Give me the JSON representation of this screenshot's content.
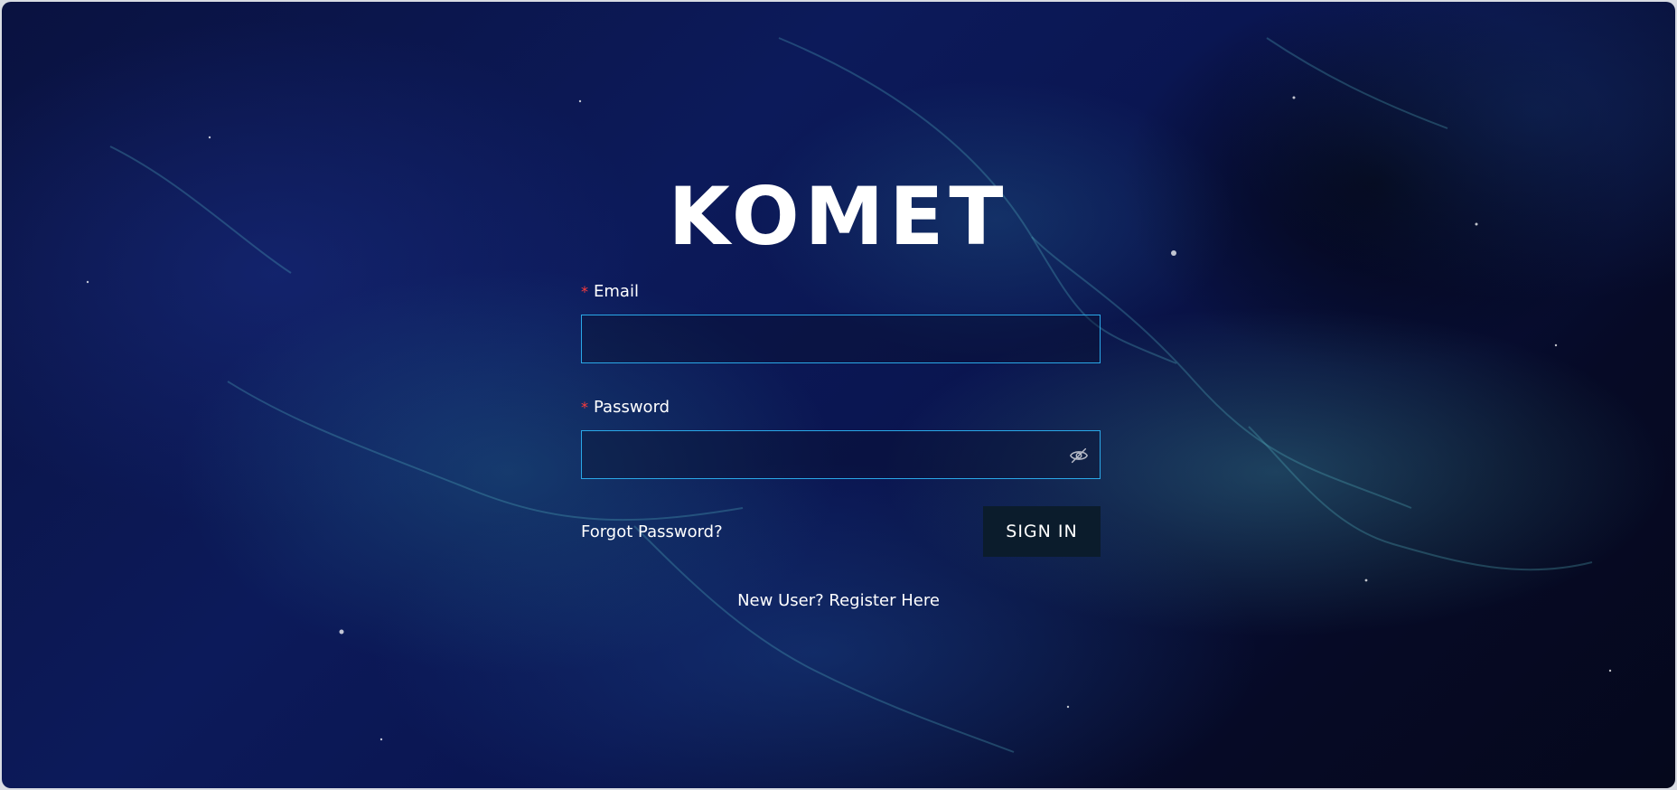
{
  "brand": {
    "title": "KOMET"
  },
  "form": {
    "email": {
      "required_mark": "*",
      "label": "Email",
      "value": "",
      "placeholder": ""
    },
    "password": {
      "required_mark": "*",
      "label": "Password",
      "value": "",
      "placeholder": "",
      "toggle_icon": "eye-slash-icon"
    },
    "forgot_link": "Forgot Password?",
    "submit_label": "SIGN IN",
    "register_link": "New User? Register Here"
  },
  "colors": {
    "input_border": "#2aa8e8",
    "required_mark": "#ff3b3b",
    "button_bg": "#0b1c2c",
    "text": "#ffffff"
  }
}
